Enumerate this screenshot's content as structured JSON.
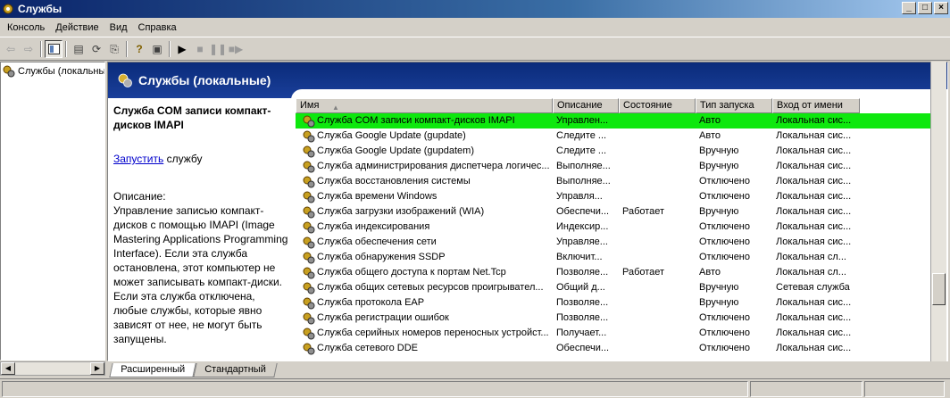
{
  "window": {
    "title": "Службы",
    "buttons": {
      "minimize": "_",
      "maximize": "□",
      "close": "×"
    }
  },
  "menu": [
    "Консоль",
    "Действие",
    "Вид",
    "Справка"
  ],
  "toolbar": {
    "icons": [
      "back-icon",
      "forward-icon",
      "show-tree-icon",
      "properties-icon",
      "refresh-icon",
      "export-icon",
      "help-icon",
      "console-icon",
      "play-icon",
      "stop-icon",
      "pause-icon",
      "restart-icon"
    ]
  },
  "tree": {
    "root_label": "Службы (локальные)"
  },
  "banner": {
    "title": "Службы (локальные)"
  },
  "details": {
    "service_title": "Служба COM записи компакт-дисков IMAPI",
    "start_link": "Запустить",
    "start_suffix": " службу",
    "description_label": "Описание:",
    "description_text": "Управление записью компакт-дисков с помощью IMAPI (Image Mastering Applications Programming Interface). Если эта служба остановлена, этот компьютер не может записывать компакт-диски. Если эта служба отключена, любые службы, которые явно зависят от нее, не могут быть запущены."
  },
  "list": {
    "columns": [
      "Имя",
      "Описание",
      "Состояние",
      "Тип запуска",
      "Вход от имени"
    ],
    "sort_indicator": "▲",
    "rows": [
      {
        "name": "Служба COM записи компакт-дисков IMAPI",
        "desc": "Управлен...",
        "state": "",
        "start": "Авто",
        "logon": "Локальная сис...",
        "selected": true
      },
      {
        "name": "Служба Google Update (gupdate)",
        "desc": "Следите ...",
        "state": "",
        "start": "Авто",
        "logon": "Локальная сис..."
      },
      {
        "name": "Служба Google Update (gupdatem)",
        "desc": "Следите ...",
        "state": "",
        "start": "Вручную",
        "logon": "Локальная сис..."
      },
      {
        "name": "Служба администрирования диспетчера логичес...",
        "desc": "Выполняе...",
        "state": "",
        "start": "Вручную",
        "logon": "Локальная сис..."
      },
      {
        "name": "Служба восстановления системы",
        "desc": "Выполняе...",
        "state": "",
        "start": "Отключено",
        "logon": "Локальная сис..."
      },
      {
        "name": "Служба времени Windows",
        "desc": "Управля...",
        "state": "",
        "start": "Отключено",
        "logon": "Локальная сис..."
      },
      {
        "name": "Служба загрузки изображений (WIA)",
        "desc": "Обеспечи...",
        "state": "Работает",
        "start": "Вручную",
        "logon": "Локальная сис..."
      },
      {
        "name": "Служба индексирования",
        "desc": "Индексир...",
        "state": "",
        "start": "Отключено",
        "logon": "Локальная сис..."
      },
      {
        "name": "Служба обеспечения сети",
        "desc": "Управляе...",
        "state": "",
        "start": "Отключено",
        "logon": "Локальная сис..."
      },
      {
        "name": "Служба обнаружения SSDP",
        "desc": "Включит...",
        "state": "",
        "start": "Отключено",
        "logon": "Локальная сл..."
      },
      {
        "name": "Служба общего доступа к портам Net.Tcp",
        "desc": "Позволяе...",
        "state": "Работает",
        "start": "Авто",
        "logon": "Локальная сл..."
      },
      {
        "name": "Служба общих сетевых ресурсов проигрывател...",
        "desc": "Общий д...",
        "state": "",
        "start": "Вручную",
        "logon": "Сетевая служба"
      },
      {
        "name": "Служба протокола EAP",
        "desc": "Позволяе...",
        "state": "",
        "start": "Вручную",
        "logon": "Локальная сис..."
      },
      {
        "name": "Служба регистрации ошибок",
        "desc": "Позволяе...",
        "state": "",
        "start": "Отключено",
        "logon": "Локальная сис..."
      },
      {
        "name": "Служба серийных номеров переносных устройст...",
        "desc": "Получает...",
        "state": "",
        "start": "Отключено",
        "logon": "Локальная сис..."
      },
      {
        "name": "Служба сетевого DDE",
        "desc": "Обеспечи...",
        "state": "",
        "start": "Отключено",
        "logon": "Локальная сис..."
      }
    ]
  },
  "tabs": [
    "Расширенный",
    "Стандартный"
  ],
  "colors": {
    "selection": "#0ee80e",
    "banner": "#0a2b7a",
    "link": "#0000cc"
  }
}
